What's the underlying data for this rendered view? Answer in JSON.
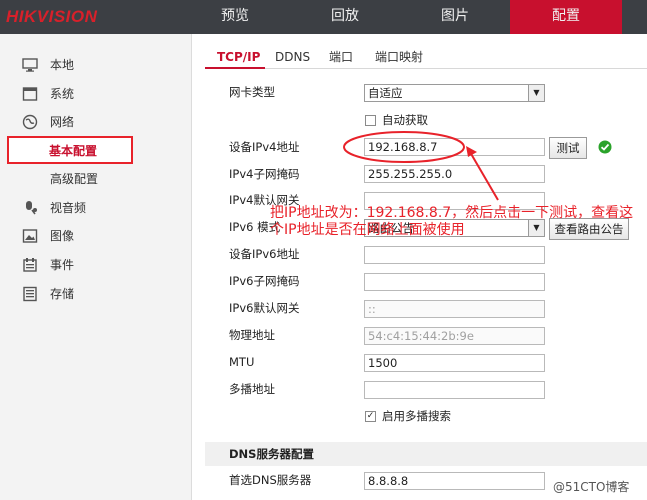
{
  "brand": {
    "logo_text": "HIKVISION",
    "accent_color": "#c8102e",
    "annotation_color": "#e8222a"
  },
  "nav": {
    "tabs": [
      "预览",
      "回放",
      "图片",
      "配置"
    ],
    "active": "配置"
  },
  "sidebar": {
    "items": [
      {
        "label": "本地",
        "icon": "monitor-icon"
      },
      {
        "label": "系统",
        "icon": "system-icon"
      },
      {
        "label": "网络",
        "icon": "globe-icon"
      },
      {
        "label": "基本配置",
        "icon": ""
      },
      {
        "label": "高级配置",
        "icon": ""
      },
      {
        "label": "视音频",
        "icon": "microphone-icon"
      },
      {
        "label": "图像",
        "icon": "image-icon"
      },
      {
        "label": "事件",
        "icon": "calendar-icon"
      },
      {
        "label": "存储",
        "icon": "storage-icon"
      }
    ],
    "active": "基本配置"
  },
  "subtabs": {
    "items": [
      "TCP/IP",
      "DDNS",
      "端口",
      "端口映射"
    ],
    "active": "TCP/IP"
  },
  "form": {
    "nic_type": {
      "label": "网卡类型",
      "value": "自适应"
    },
    "dhcp": {
      "label": "自动获取",
      "checked": false
    },
    "ipv4_address": {
      "label": "设备IPv4地址",
      "value": "192.168.8.7"
    },
    "test_button": "测试",
    "ipv4_mask": {
      "label": "IPv4子网掩码",
      "value": "255.255.255.0"
    },
    "ipv4_gateway": {
      "label": "IPv4默认网关",
      "value": ""
    },
    "ipv6_mode": {
      "label": "IPv6 模式",
      "value": "路由公告"
    },
    "view_route_button": "查看路由公告",
    "ipv6_address": {
      "label": "设备IPv6地址",
      "value": ""
    },
    "ipv6_prefix": {
      "label": "IPv6子网掩码",
      "value": ""
    },
    "ipv6_gateway": {
      "label": "IPv6默认网关",
      "value": "::"
    },
    "mac_address": {
      "label": "物理地址",
      "value": "54:c4:15:44:2b:9e"
    },
    "mtu": {
      "label": "MTU",
      "value": "1500"
    },
    "multicast": {
      "label": "多播地址",
      "value": ""
    },
    "multicast_search": {
      "label": "启用多播搜索",
      "checked": true
    }
  },
  "dns": {
    "section_title": "DNS服务器配置",
    "primary": {
      "label": "首选DNS服务器",
      "value": "8.8.8.8"
    }
  },
  "annotation": {
    "text": "把IP地址改为：192.168.8.7，然后点击一下测试，查看这个IP地址是否在网络上面被使用"
  },
  "watermark": "@51CTO博客"
}
